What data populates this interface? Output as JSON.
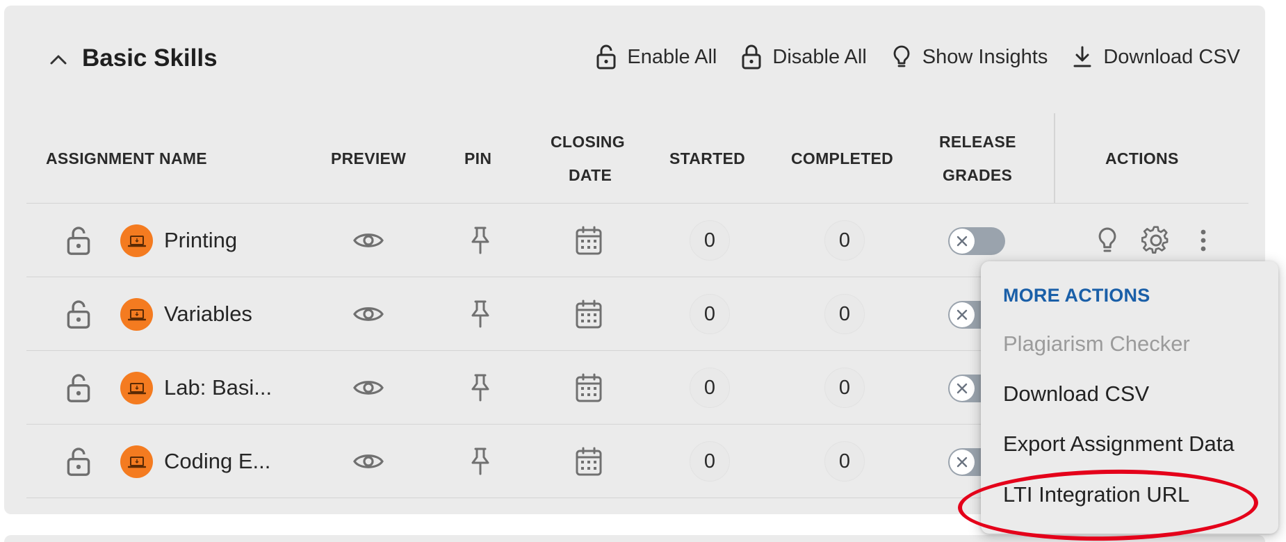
{
  "section": {
    "title": "Basic Skills"
  },
  "toolbar": {
    "enable_all": "Enable All",
    "disable_all": "Disable All",
    "show_insights": "Show Insights",
    "download_csv": "Download CSV"
  },
  "table": {
    "headers": {
      "assignment_name": "ASSIGNMENT NAME",
      "preview": "PREVIEW",
      "pin": "PIN",
      "closing_date_1": "CLOSING",
      "closing_date_2": "DATE",
      "started": "STARTED",
      "completed": "COMPLETED",
      "release_1": "RELEASE",
      "release_2": "GRADES",
      "actions": "ACTIONS"
    },
    "rows": [
      {
        "name": "Printing",
        "started": "0",
        "completed": "0"
      },
      {
        "name": "Variables",
        "started": "0",
        "completed": "0"
      },
      {
        "name": "Lab: Basi...",
        "started": "0",
        "completed": "0"
      },
      {
        "name": "Coding E...",
        "started": "0",
        "completed": "0"
      }
    ]
  },
  "menu": {
    "title": "MORE ACTIONS",
    "items": [
      {
        "label": "Plagiarism Checker",
        "disabled": true
      },
      {
        "label": "Download CSV",
        "disabled": false
      },
      {
        "label": "Export Assignment Data",
        "disabled": false
      },
      {
        "label": "LTI Integration URL",
        "disabled": false,
        "highlighted": true
      }
    ]
  },
  "colors": {
    "avatar": "#f47b20",
    "menu_title": "#1a5fa8",
    "highlight": "#e4001a",
    "toggle_off": "#9aa3ad",
    "panel_bg": "#ebebeb"
  },
  "icons": {
    "collapse": "chevron-up-icon",
    "lock": "lock-open-icon",
    "preview": "eye-icon",
    "pin": "pin-icon",
    "date": "calendar-icon",
    "insights": "lightbulb-icon",
    "settings": "gear-icon",
    "more": "more-vertical-icon",
    "download": "download-icon",
    "assignment": "laptop-icon"
  }
}
